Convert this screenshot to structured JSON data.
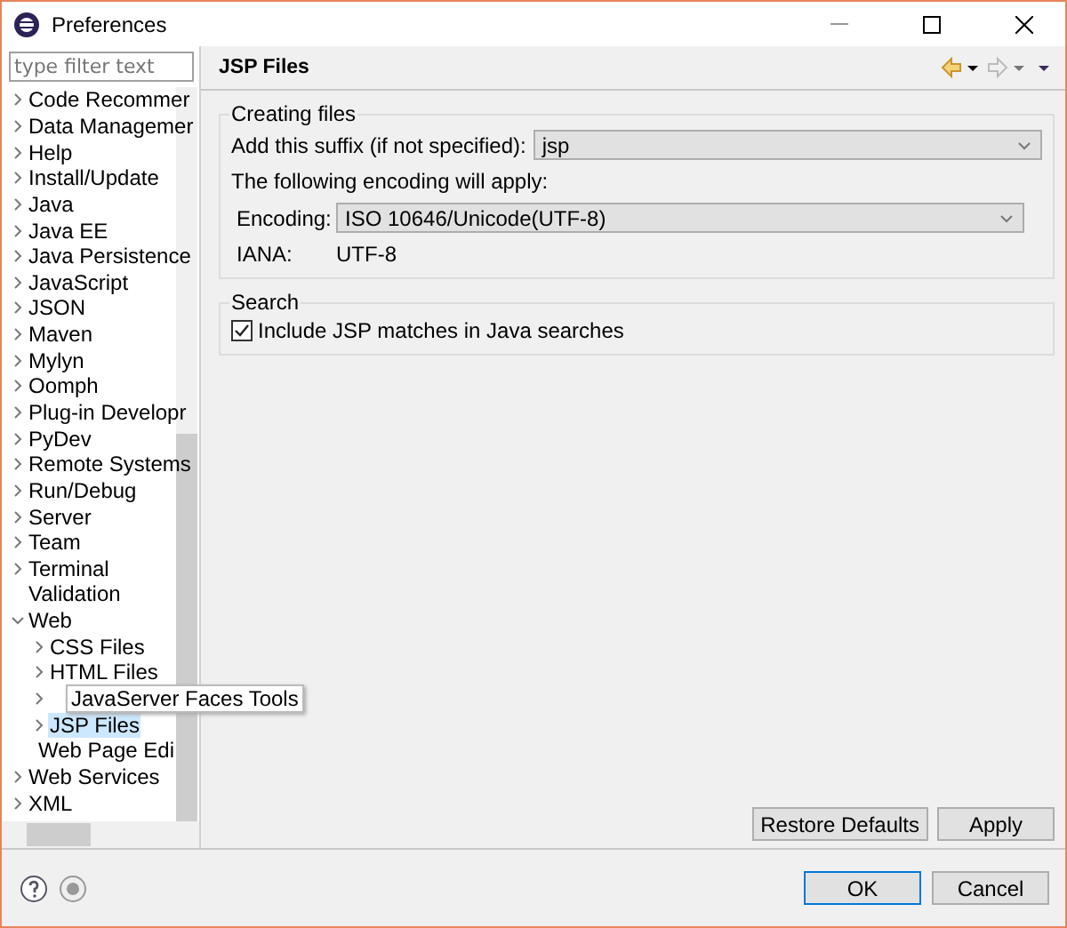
{
  "window": {
    "title": "Preferences"
  },
  "filter": {
    "placeholder": "type filter text"
  },
  "tree": [
    {
      "label": "Code Recommer",
      "kind": "folder",
      "expanded": false,
      "selected": false
    },
    {
      "label": "Data Managemer",
      "kind": "folder",
      "expanded": false,
      "selected": false
    },
    {
      "label": "Help",
      "kind": "folder",
      "expanded": false,
      "selected": false
    },
    {
      "label": "Install/Update",
      "kind": "folder",
      "expanded": false,
      "selected": false
    },
    {
      "label": "Java",
      "kind": "folder",
      "expanded": false,
      "selected": false
    },
    {
      "label": "Java EE",
      "kind": "folder",
      "expanded": false,
      "selected": false
    },
    {
      "label": "Java Persistence",
      "kind": "folder",
      "expanded": false,
      "selected": false
    },
    {
      "label": "JavaScript",
      "kind": "folder",
      "expanded": false,
      "selected": false
    },
    {
      "label": "JSON",
      "kind": "folder",
      "expanded": false,
      "selected": false
    },
    {
      "label": "Maven",
      "kind": "folder",
      "expanded": false,
      "selected": false
    },
    {
      "label": "Mylyn",
      "kind": "folder",
      "expanded": false,
      "selected": false
    },
    {
      "label": "Oomph",
      "kind": "folder",
      "expanded": false,
      "selected": false
    },
    {
      "label": "Plug-in Developr",
      "kind": "folder",
      "expanded": false,
      "selected": false
    },
    {
      "label": "PyDev",
      "kind": "folder",
      "expanded": false,
      "selected": false
    },
    {
      "label": "Remote Systems",
      "kind": "folder",
      "expanded": false,
      "selected": false
    },
    {
      "label": "Run/Debug",
      "kind": "folder",
      "expanded": false,
      "selected": false
    },
    {
      "label": "Server",
      "kind": "folder",
      "expanded": false,
      "selected": false
    },
    {
      "label": "Team",
      "kind": "folder",
      "expanded": false,
      "selected": false
    },
    {
      "label": "Terminal",
      "kind": "folder",
      "expanded": false,
      "selected": false
    },
    {
      "label": "Validation",
      "kind": "leaf",
      "selected": false
    },
    {
      "label": "Web",
      "kind": "folder",
      "expanded": true,
      "selected": false,
      "children": [
        {
          "label": "CSS Files",
          "kind": "folder",
          "expanded": false,
          "selected": false
        },
        {
          "label": "HTML Files",
          "kind": "folder",
          "expanded": false,
          "selected": false
        },
        {
          "label": "JavaServer Faces Tools",
          "kind": "folder",
          "expanded": false,
          "selected": false
        },
        {
          "label": "JSP Files",
          "kind": "folder",
          "expanded": false,
          "selected": true
        },
        {
          "label": "Web Page Edi",
          "kind": "leaf",
          "selected": false
        }
      ]
    },
    {
      "label": "Web Services",
      "kind": "folder",
      "expanded": false,
      "selected": false
    },
    {
      "label": "XML",
      "kind": "folder",
      "expanded": false,
      "selected": false
    }
  ],
  "page": {
    "title": "JSP Files",
    "creating": {
      "legend": "Creating files",
      "suffix_label": "Add this suffix (if not specified):",
      "suffix_value": "jsp",
      "encoding_note": "The following encoding will apply:",
      "encoding_label": "Encoding:",
      "encoding_value": "ISO 10646/Unicode(UTF-8)",
      "iana_label": "IANA:",
      "iana_value": "UTF-8"
    },
    "search": {
      "legend": "Search",
      "option": {
        "label": "Include JSP matches in Java searches",
        "checked": true
      }
    },
    "buttons": [
      "Restore Defaults",
      "Apply"
    ]
  },
  "footer": {
    "buttons": [
      {
        "label": "OK",
        "default": true
      },
      {
        "label": "Cancel",
        "default": false
      }
    ]
  }
}
